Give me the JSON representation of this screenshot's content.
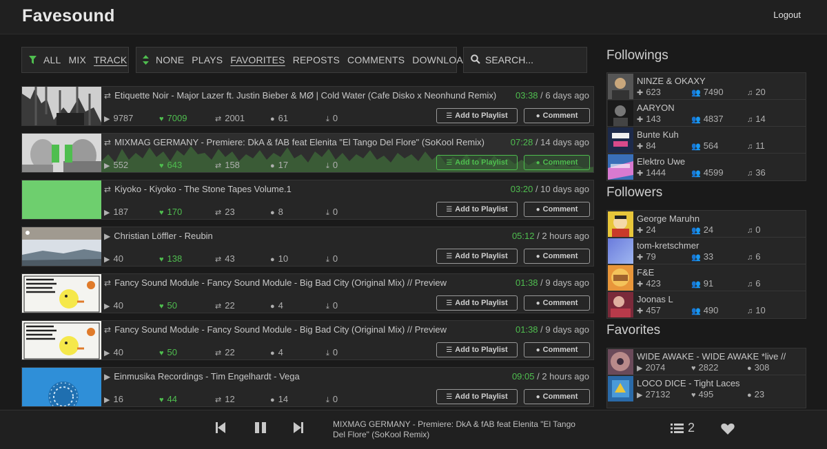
{
  "header": {
    "brand": "Favesound",
    "logout": "Logout"
  },
  "filters": {
    "type": [
      "ALL",
      "MIX",
      "TRACK"
    ],
    "type_active": "TRACK",
    "sort": [
      "NONE",
      "PLAYS",
      "FAVORITES",
      "REPOSTS",
      "COMMENTS",
      "DOWNLOADS"
    ],
    "sort_active": "FAVORITES",
    "search_placeholder": "SEARCH..."
  },
  "buttons": {
    "add_playlist": "Add to Playlist",
    "comment": "Comment"
  },
  "tracks": [
    {
      "title": "Etiquette Noir - Major Lazer ft. Justin Bieber & MØ | Cold Water (Cafe Disko x Neonhund Remix)",
      "kind": "repost",
      "duration": "03:38",
      "ago": " / 6 days ago",
      "plays": "9787",
      "likes": "7009",
      "reposts": "2001",
      "comments": "61",
      "downloads": "0",
      "playing": false
    },
    {
      "title": "MIXMAG GERMANY - Premiere: DkA & fAB feat Elenita \"El Tango Del Flore\" (SoKool Remix)",
      "kind": "repost",
      "duration": "07:28",
      "ago": " / 14 days ago",
      "plays": "552",
      "likes": "643",
      "reposts": "158",
      "comments": "17",
      "downloads": "0",
      "playing": true
    },
    {
      "title": "Kiyoko - Kiyoko - The Stone Tapes Volume.1",
      "kind": "repost",
      "duration": "03:20",
      "ago": " / 10 days ago",
      "plays": "187",
      "likes": "170",
      "reposts": "23",
      "comments": "8",
      "downloads": "0",
      "playing": false
    },
    {
      "title": "Christian Löffler - Reubin",
      "kind": "play",
      "duration": "05:12",
      "ago": " / 2 hours ago",
      "plays": "40",
      "likes": "138",
      "reposts": "43",
      "comments": "10",
      "downloads": "0",
      "playing": false
    },
    {
      "title": "Fancy Sound Module - Fancy Sound Module - Big Bad City (Original Mix) // Preview",
      "kind": "repost",
      "duration": "01:38",
      "ago": " / 9 days ago",
      "plays": "40",
      "likes": "50",
      "reposts": "22",
      "comments": "4",
      "downloads": "0",
      "playing": false
    },
    {
      "title": "Fancy Sound Module - Fancy Sound Module - Big Bad City (Original Mix) // Preview",
      "kind": "repost",
      "duration": "01:38",
      "ago": " / 9 days ago",
      "plays": "40",
      "likes": "50",
      "reposts": "22",
      "comments": "4",
      "downloads": "0",
      "playing": false
    },
    {
      "title": "Einmusika Recordings - Tim Engelhardt - Vega",
      "kind": "play",
      "duration": "09:05",
      "ago": " / 2 hours ago",
      "plays": "16",
      "likes": "44",
      "reposts": "12",
      "comments": "14",
      "downloads": "0",
      "playing": false
    }
  ],
  "followings": {
    "heading": "Followings",
    "items": [
      {
        "name": "NINZE & OKAXY",
        "a": "623",
        "b": "7490",
        "c": "20"
      },
      {
        "name": "AARYON",
        "a": "143",
        "b": "4837",
        "c": "14"
      },
      {
        "name": "Bunte Kuh",
        "a": "84",
        "b": "564",
        "c": "11"
      },
      {
        "name": "Elektro Uwe",
        "a": "1444",
        "b": "4599",
        "c": "36"
      }
    ]
  },
  "followers": {
    "heading": "Followers",
    "items": [
      {
        "name": "George Maruhn",
        "a": "24",
        "b": "24",
        "c": "0"
      },
      {
        "name": "tom-kretschmer",
        "a": "79",
        "b": "33",
        "c": "6"
      },
      {
        "name": "F&E",
        "a": "423",
        "b": "91",
        "c": "6"
      },
      {
        "name": "Joonas L",
        "a": "457",
        "b": "490",
        "c": "10"
      }
    ]
  },
  "favorites": {
    "heading": "Favorites",
    "items": [
      {
        "name": "WIDE AWAKE - WIDE AWAKE *live //",
        "a": "2074",
        "b": "2822",
        "c": "308"
      },
      {
        "name": "LOCO DICE - Tight Laces",
        "a": "27132",
        "b": "495",
        "c": "23"
      }
    ]
  },
  "player": {
    "now_playing": "MIXMAG GERMANY - Premiere: DkA & fAB feat Elenita \"El Tango Del Flore\" (SoKool Remix)",
    "queue_count": "2"
  },
  "colors": {
    "accent": "#4fbe4f",
    "background": "#1a1a1a",
    "panel": "#262626"
  }
}
